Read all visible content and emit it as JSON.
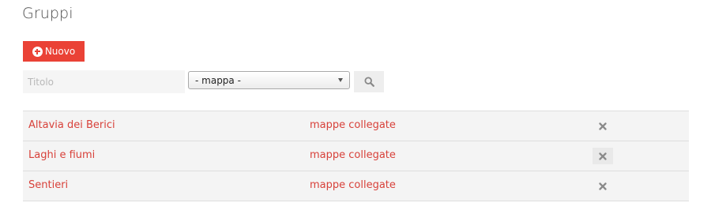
{
  "page": {
    "title": "Gruppi"
  },
  "toolbar": {
    "new_label": "Nuovo"
  },
  "filters": {
    "title_placeholder": "Titolo",
    "map_select_value": "- mappa -"
  },
  "colors": {
    "accent": "#ea4236",
    "link": "#d8413a"
  },
  "icons": {
    "new": "plus-circle-icon",
    "search": "search-icon",
    "delete": "close-icon"
  },
  "groups": [
    {
      "name": "Altavia dei Berici",
      "maps_link": "mappe collegate"
    },
    {
      "name": "Laghi e fiumi",
      "maps_link": "mappe collegate"
    },
    {
      "name": "Sentieri",
      "maps_link": "mappe collegate"
    }
  ]
}
